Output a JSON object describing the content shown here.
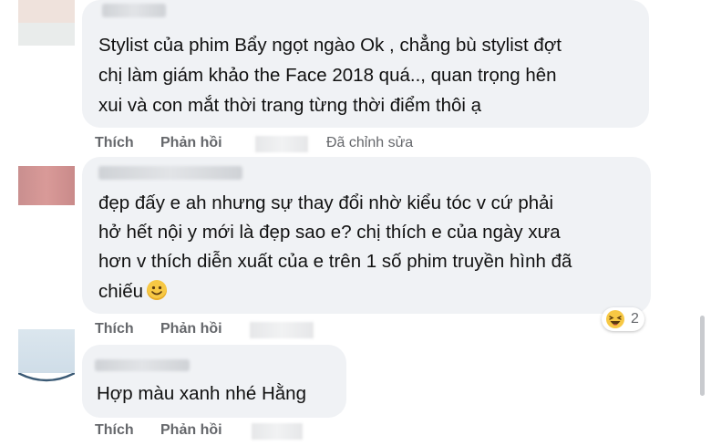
{
  "comments": [
    {
      "lines": [
        "Stylist của phim Bẩy ngọt ngào Ok , chẳng bù stylist đợt",
        "chị làm giám khảo the Face 2018 quá.., quan trọng hên",
        "xui và con mắt thời trang từng thời điểm thôi ạ"
      ],
      "actions": {
        "like": "Thích",
        "reply": "Phản hồi",
        "edited": "Đã chỉnh sửa"
      }
    },
    {
      "lines": [
        "đẹp đấy e ah nhưng sự thay đổi nhờ kiểu tóc v cứ phải",
        "hở hết nội y mới là đẹp sao e? chị thích e của ngày xưa",
        "hơn v thích diễn xuất của e trên 1 số phim truyền hình đã",
        "chiếu"
      ],
      "emoji": "slightly-smiling-face",
      "actions": {
        "like": "Thích",
        "reply": "Phản hồi"
      },
      "reaction": {
        "icon": "laughing-face-icon",
        "count": "2"
      }
    },
    {
      "lines": [
        "Hợp màu xanh nhé Hằng"
      ],
      "actions": {
        "like": "Thích",
        "reply": "Phản hồi"
      }
    }
  ],
  "colors": {
    "bubble": "#f0f2f5",
    "action_text": "#65676b",
    "text": "#050505",
    "reaction_yellow": "#f7c844"
  }
}
